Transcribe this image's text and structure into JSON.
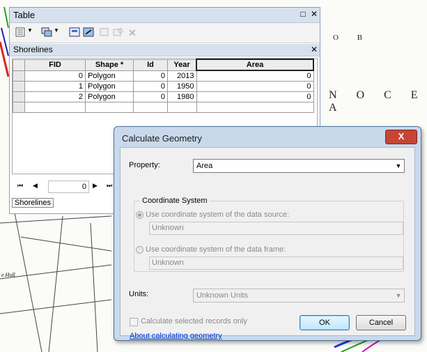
{
  "map": {
    "labels": [
      "O B",
      "N   O C E A"
    ],
    "snippet": "e Holl"
  },
  "table_window": {
    "title": "Table",
    "layer_name": "Shorelines",
    "columns": [
      "FID",
      "Shape *",
      "Id",
      "Year",
      "Area"
    ],
    "rows": [
      {
        "fid": "0",
        "shape": "Polygon",
        "id": "0",
        "year": "2013",
        "area": "0"
      },
      {
        "fid": "1",
        "shape": "Polygon",
        "id": "0",
        "year": "1950",
        "area": "0"
      },
      {
        "fid": "2",
        "shape": "Polygon",
        "id": "0",
        "year": "1980",
        "area": "0"
      }
    ],
    "nav": {
      "record": "0"
    },
    "tab_label": "Shorelines"
  },
  "dialog": {
    "title": "Calculate Geometry",
    "close_label": "X",
    "property_label": "Property:",
    "property_value": "Area",
    "coord_group_label": "Coordinate System",
    "use_data_source": "Use coordinate system of the data source:",
    "data_source_value": "Unknown",
    "use_data_frame": "Use coordinate system of the data frame:",
    "data_frame_value": "Unknown",
    "units_label": "Units:",
    "units_value": "Unknown Units",
    "selected_only": "Calculate selected records only",
    "help_link": "About calculating geometry",
    "ok": "OK",
    "cancel": "Cancel"
  }
}
